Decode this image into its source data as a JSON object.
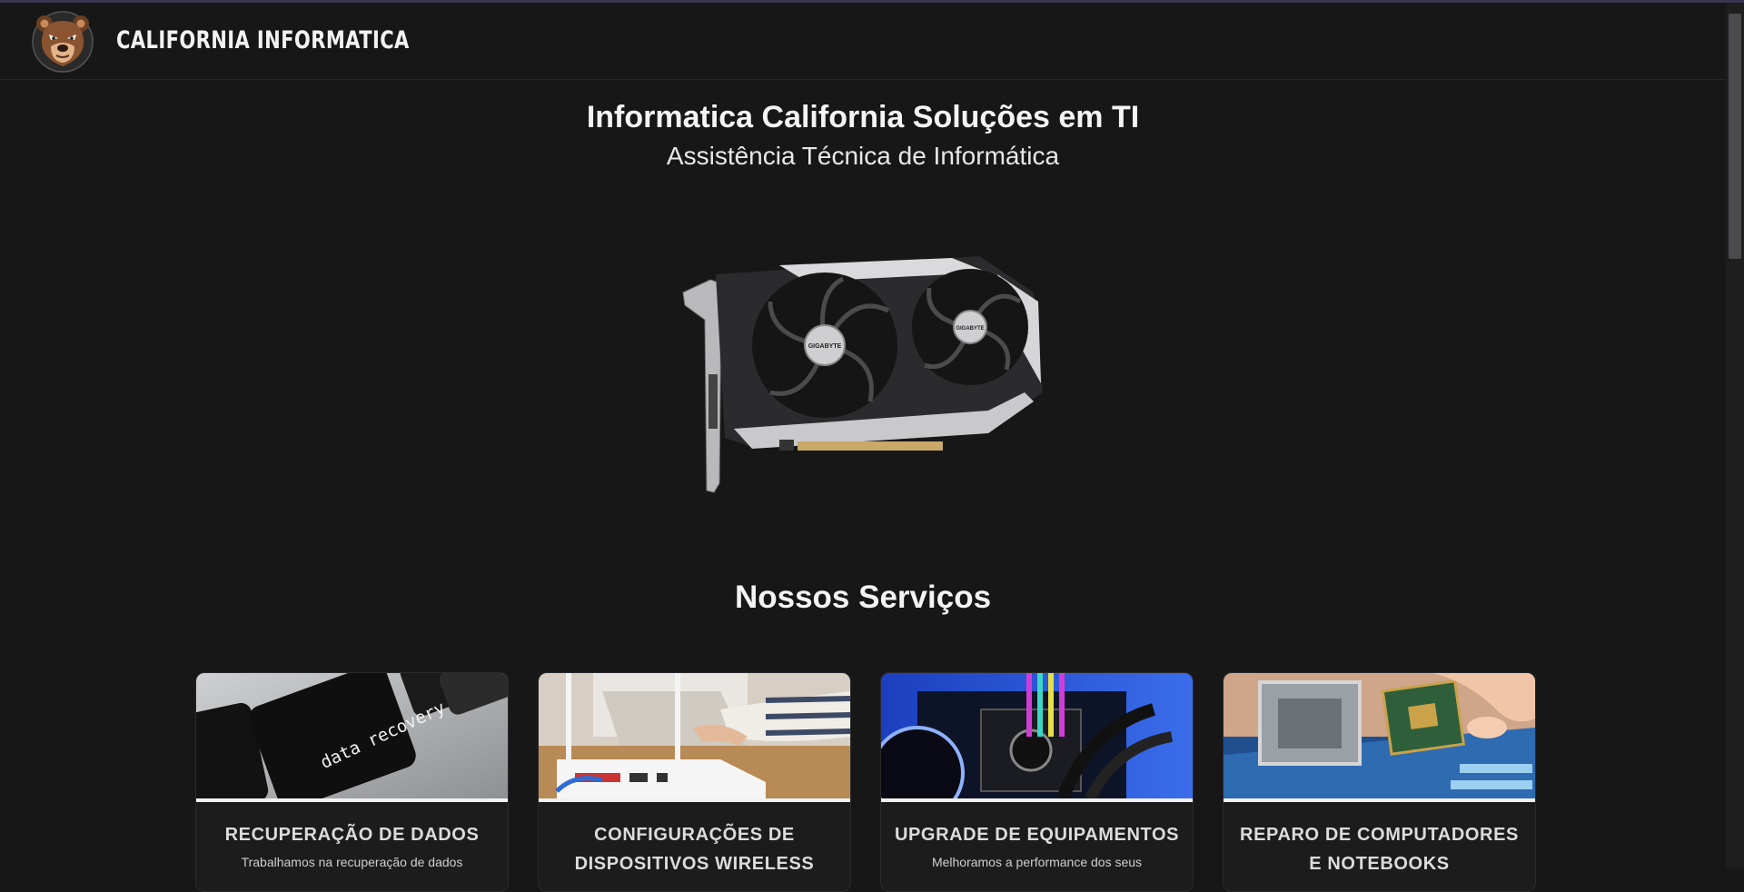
{
  "header": {
    "brand": "CALIFORNIA INFORMATICA",
    "logo_icon": "bear-head-logo"
  },
  "hero": {
    "title": "Informatica California Soluções em TI",
    "subtitle": "Assistência Técnica de Informática",
    "image_icon": "graphics-card-image",
    "gpu_label": "GIGABYTE"
  },
  "services": {
    "title": "Nossos Serviços",
    "cards": [
      {
        "title": "RECUPERAÇÃO DE DADOS",
        "description": "Trabalhamos na recuperação de dados",
        "image_icon": "data-recovery-key-image",
        "image_text": "data recovery"
      },
      {
        "title": "CONFIGURAÇÕES DE DISPOSITIVOS WIRELESS",
        "description": "",
        "image_icon": "wireless-router-image"
      },
      {
        "title": "UPGRADE DE EQUIPAMENTOS",
        "description": "Melhoramos a performance dos seus",
        "image_icon": "pc-upgrade-image"
      },
      {
        "title": "REPARO DE COMPUTADORES E NOTEBOOKS",
        "description": "",
        "image_icon": "cpu-repair-image"
      }
    ]
  },
  "colors": {
    "background": "#171718",
    "text": "#ffffff",
    "card_background": "#1c1c1d"
  }
}
